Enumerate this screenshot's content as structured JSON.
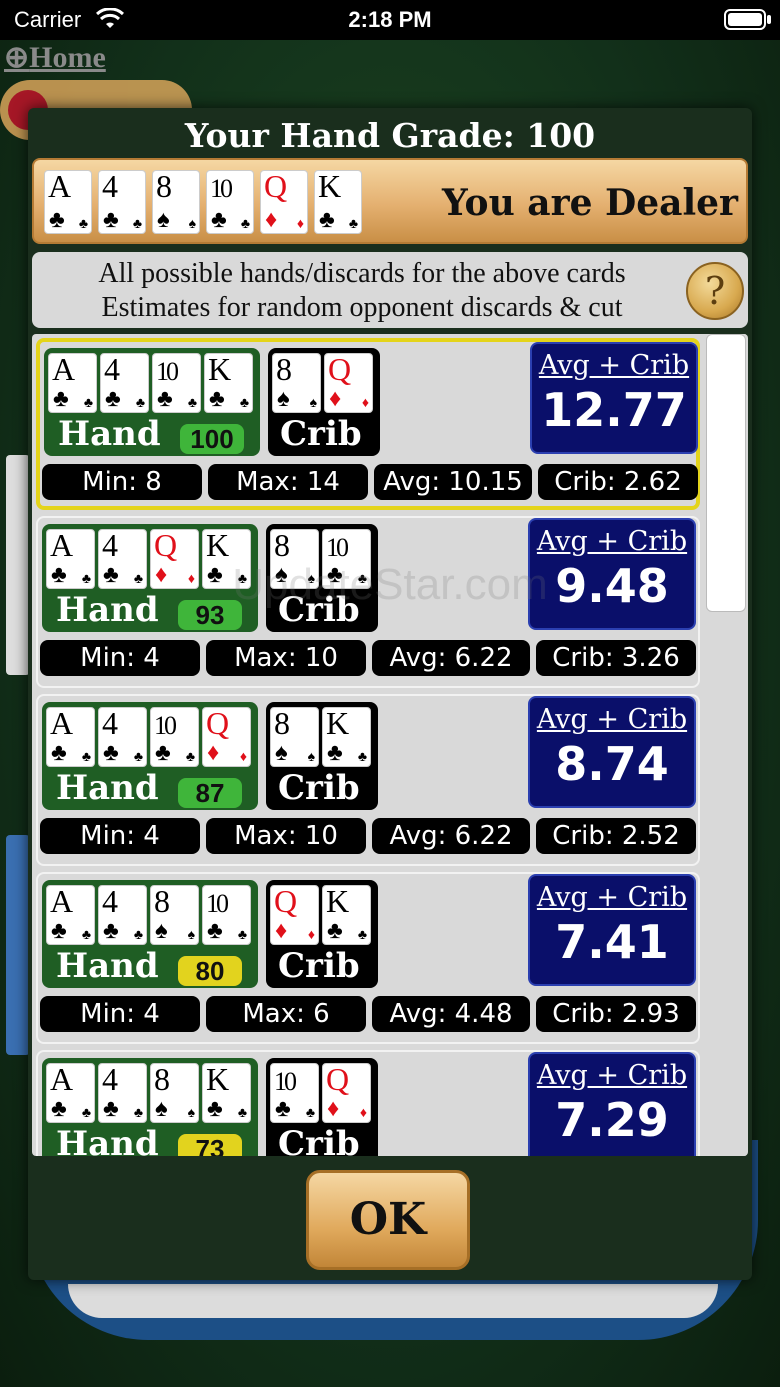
{
  "status_bar": {
    "carrier": "Carrier",
    "time": "2:18 PM"
  },
  "nav": {
    "home_label": "Home"
  },
  "dialog": {
    "title": "Your Hand Grade: 100",
    "dealer_text": "You are Dealer",
    "info_line1": "All possible hands/discards for the above cards",
    "info_line2": "Estimates for random opponent discards & cut",
    "help_symbol": "?",
    "ok_label": "OK",
    "hand_label": "Hand",
    "crib_label": "Crib",
    "avg_crib_label": "Avg + Crib"
  },
  "dealt_cards": [
    {
      "rank": "A",
      "suit": "♣",
      "color": "black"
    },
    {
      "rank": "4",
      "suit": "♣",
      "color": "black"
    },
    {
      "rank": "8",
      "suit": "♠",
      "color": "black"
    },
    {
      "rank": "10",
      "suit": "♣",
      "color": "black"
    },
    {
      "rank": "Q",
      "suit": "♦",
      "color": "red"
    },
    {
      "rank": "K",
      "suit": "♣",
      "color": "black"
    }
  ],
  "options": [
    {
      "grade": "100",
      "grade_color": "#3fb53a",
      "hand": [
        {
          "rank": "A",
          "suit": "♣",
          "color": "black"
        },
        {
          "rank": "4",
          "suit": "♣",
          "color": "black"
        },
        {
          "rank": "10",
          "suit": "♣",
          "color": "black"
        },
        {
          "rank": "K",
          "suit": "♣",
          "color": "black"
        }
      ],
      "crib": [
        {
          "rank": "8",
          "suit": "♠",
          "color": "black"
        },
        {
          "rank": "Q",
          "suit": "♦",
          "color": "red"
        }
      ],
      "avg_crib": "12.77",
      "min": "Min: 8",
      "max": "Max: 14",
      "avg": "Avg: 10.15",
      "crib_value": "Crib: 2.62",
      "selected": true
    },
    {
      "grade": "93",
      "grade_color": "#3fb53a",
      "hand": [
        {
          "rank": "A",
          "suit": "♣",
          "color": "black"
        },
        {
          "rank": "4",
          "suit": "♣",
          "color": "black"
        },
        {
          "rank": "Q",
          "suit": "♦",
          "color": "red"
        },
        {
          "rank": "K",
          "suit": "♣",
          "color": "black"
        }
      ],
      "crib": [
        {
          "rank": "8",
          "suit": "♠",
          "color": "black"
        },
        {
          "rank": "10",
          "suit": "♣",
          "color": "black"
        }
      ],
      "avg_crib": "9.48",
      "min": "Min: 4",
      "max": "Max: 10",
      "avg": "Avg: 6.22",
      "crib_value": "Crib: 3.26",
      "selected": false
    },
    {
      "grade": "87",
      "grade_color": "#3fb53a",
      "hand": [
        {
          "rank": "A",
          "suit": "♣",
          "color": "black"
        },
        {
          "rank": "4",
          "suit": "♣",
          "color": "black"
        },
        {
          "rank": "10",
          "suit": "♣",
          "color": "black"
        },
        {
          "rank": "Q",
          "suit": "♦",
          "color": "red"
        }
      ],
      "crib": [
        {
          "rank": "8",
          "suit": "♠",
          "color": "black"
        },
        {
          "rank": "K",
          "suit": "♣",
          "color": "black"
        }
      ],
      "avg_crib": "8.74",
      "min": "Min: 4",
      "max": "Max: 10",
      "avg": "Avg: 6.22",
      "crib_value": "Crib: 2.52",
      "selected": false
    },
    {
      "grade": "80",
      "grade_color": "#e2d31e",
      "hand": [
        {
          "rank": "A",
          "suit": "♣",
          "color": "black"
        },
        {
          "rank": "4",
          "suit": "♣",
          "color": "black"
        },
        {
          "rank": "8",
          "suit": "♠",
          "color": "black"
        },
        {
          "rank": "10",
          "suit": "♣",
          "color": "black"
        }
      ],
      "crib": [
        {
          "rank": "Q",
          "suit": "♦",
          "color": "red"
        },
        {
          "rank": "K",
          "suit": "♣",
          "color": "black"
        }
      ],
      "avg_crib": "7.41",
      "min": "Min: 4",
      "max": "Max: 6",
      "avg": "Avg: 4.48",
      "crib_value": "Crib: 2.93",
      "selected": false
    },
    {
      "grade": "73",
      "grade_color": "#e2d31e",
      "hand": [
        {
          "rank": "A",
          "suit": "♣",
          "color": "black"
        },
        {
          "rank": "4",
          "suit": "♣",
          "color": "black"
        },
        {
          "rank": "8",
          "suit": "♠",
          "color": "black"
        },
        {
          "rank": "K",
          "suit": "♣",
          "color": "black"
        }
      ],
      "crib": [
        {
          "rank": "10",
          "suit": "♣",
          "color": "black"
        },
        {
          "rank": "Q",
          "suit": "♦",
          "color": "red"
        }
      ],
      "avg_crib": "7.29",
      "min": "",
      "max": "",
      "avg": "",
      "crib_value": "",
      "selected": false
    }
  ],
  "watermark": "UpdateStar.com"
}
